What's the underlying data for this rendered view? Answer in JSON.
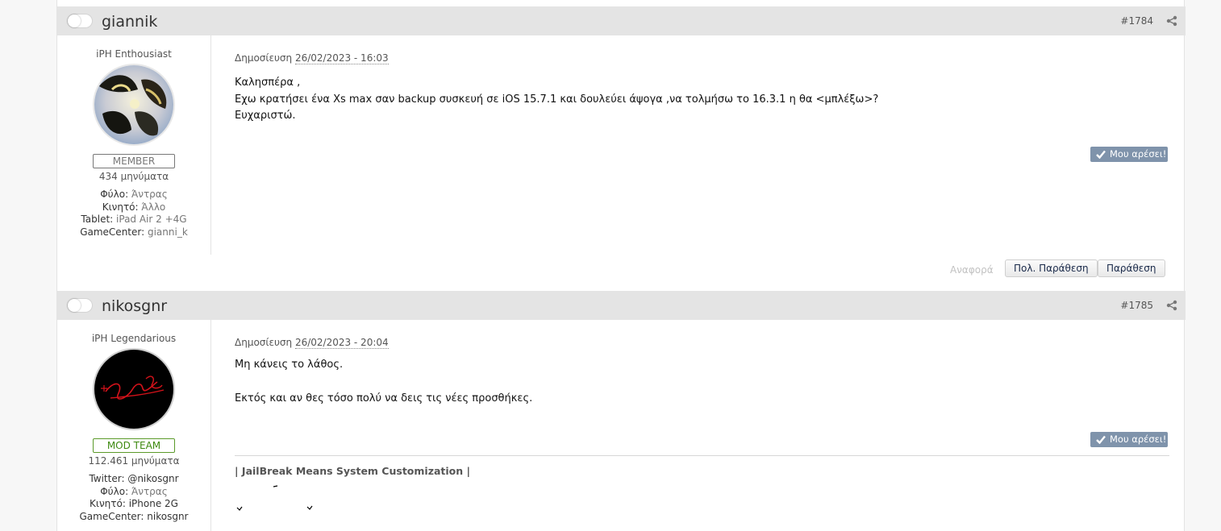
{
  "posts": [
    {
      "username": "giannik",
      "post_number": "#1784",
      "user_title": "iPH Enthousiast",
      "rank": "MEMBER",
      "message_count": "434 μηνύματα",
      "fields": [
        {
          "key": "Φύλο:",
          "value": "Άντρας"
        },
        {
          "key": "Κινητό:",
          "value": "Άλλο"
        },
        {
          "key": "Tablet:",
          "value": "iPad Air 2 +4G"
        },
        {
          "key": "GameCenter:",
          "value": "gianni_k"
        }
      ],
      "date_label": "Δημοσίευση",
      "date": "26/02/2023 - 16:03",
      "lines": [
        "Καλησπέρα ,",
        "Εχω κρατήσει ένα   Xs max σαν backup συσκευή σε iOS 15.7.1 και δουλεύει άψογα ,να τολμήσω το 16.3.1 η θα <μπλέξω>?",
        "Ευχαριστώ."
      ],
      "like_label": "Μου αρέσει!",
      "report_label": "Αναφορά",
      "multiquote_label": "Πολ. Παράθεση",
      "quote_label": "Παράθεση"
    },
    {
      "username": "nikosgnr",
      "post_number": "#1785",
      "user_title": "iPH Legendarious",
      "rank": "MOD TEAM",
      "message_count": "112.461 μηνύματα",
      "fields": [
        {
          "key": "Twitter:",
          "value": "@nikosgnr"
        },
        {
          "key": "Φύλο:",
          "value": "Άντρας"
        },
        {
          "key": "Κινητό:",
          "value": "iPhone 2G"
        },
        {
          "key": "GameCenter:",
          "value": "nikosgnr"
        }
      ],
      "date_label": "Δημοσίευση",
      "date": "26/02/2023 - 20:04",
      "lines": [
        "Μη κάνεις το λάθος.",
        "",
        "Εκτός και αν θες τόσο πολύ να δεις τις νέες προσθήκες."
      ],
      "like_label": "Μου αρέσει!",
      "signature": "| JailBreak Means System Customization |"
    }
  ],
  "colors": {
    "header_bg": "#e4e4e4",
    "like_bg": "#7f93ab",
    "mod_green": "#3f8a12"
  }
}
